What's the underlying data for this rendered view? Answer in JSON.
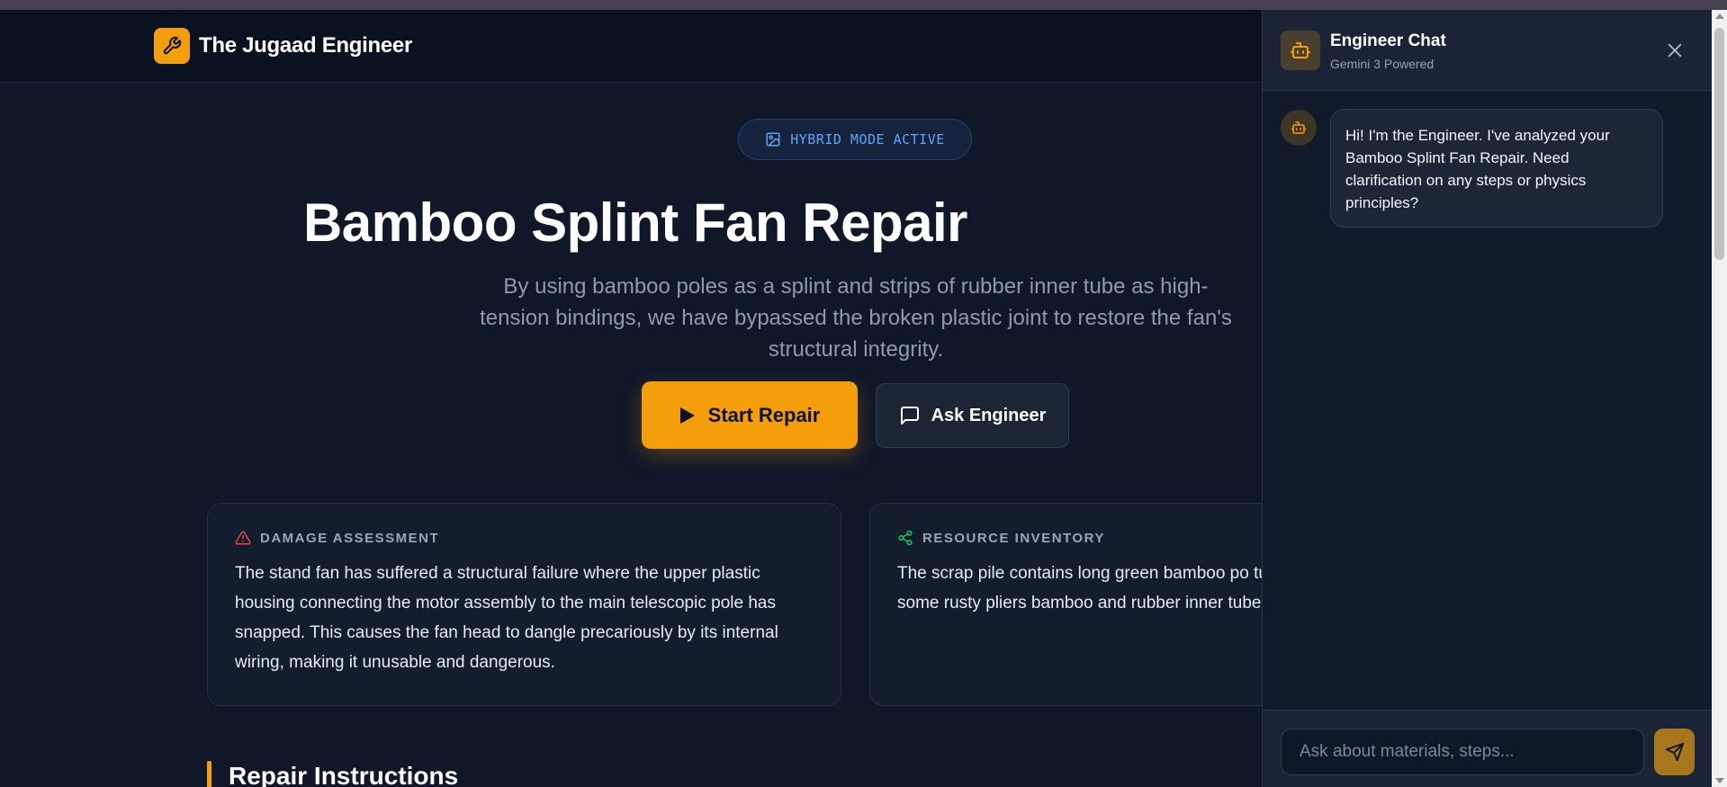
{
  "navbar": {
    "brand_title": "The Jugaad Engineer",
    "brand_icon": "wrench-icon"
  },
  "hero": {
    "mode_badge": "HYBRID MODE ACTIVE",
    "title": "Bamboo Splint Fan Repair",
    "subtitle": "By using bamboo poles as a splint and strips of rubber inner tube as high-tension bindings, we have bypassed the broken plastic joint to restore the fan's structural integrity.",
    "start_button": "Start Repair",
    "ask_button": "Ask Engineer"
  },
  "cards": {
    "damage": {
      "label": "DAMAGE ASSESSMENT",
      "icon": "warning-triangle-icon",
      "text": "The stand fan has suffered a structural failure where the upper plastic housing connecting the motor assembly to the main telescopic pole has snapped. This causes the fan head to dangle precariously by its internal wiring, making it unusable and dangerous."
    },
    "resource": {
      "label": "RESOURCE INVENTORY",
      "icon": "share-nodes-icon",
      "text": "The scrap pile contains long green bamboo po tubes, several plastic bottles, some rusty pliers bamboo and rubber inner tubes are perfect fo brace."
    }
  },
  "section": {
    "title": "Repair Instructions"
  },
  "chat": {
    "title": "Engineer Chat",
    "subtitle": "Gemini 3 Powered",
    "bot_message": "Hi! I'm the Engineer. I've analyzed your Bamboo Splint Fan Repair. Need clarification on any steps or physics principles?",
    "input_placeholder": "Ask about materials, steps...",
    "input_value": ""
  },
  "colors": {
    "accent": "#f59e0b",
    "background": "#0f1729",
    "badge_text": "#60a5fa",
    "danger": "#ef4444",
    "success": "#22c55e"
  }
}
